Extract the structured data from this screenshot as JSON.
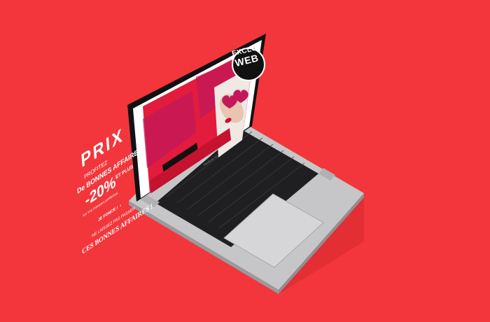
{
  "colors": {
    "background": "#f2363b",
    "promo_red": "#e31b3c",
    "promo_magenta": "#c2185b",
    "laptop_silver": "#c9c9cb",
    "keyboard_dark": "#1e1e20"
  },
  "badge": {
    "line1": "EXCLU",
    "line2": "WEB"
  },
  "promo": {
    "title": "PRIX",
    "subtitle": "PROFITEZ",
    "deal": "De BONNES AFFAIRES !",
    "discount": "-20%",
    "discount_suffix": "ET PLUS",
    "detail": "sur vos marques préférées",
    "cta_label": "JE FONCE !",
    "cta_arrow": "›",
    "tagline1": "NE LAISSEZ PAS PASSER",
    "tagline2": "CES BONNES AFFAIRES !"
  },
  "hero_image": {
    "icon": "woman-with-heart-sunglasses"
  },
  "laptop": {
    "label": "MacBook Pro"
  }
}
